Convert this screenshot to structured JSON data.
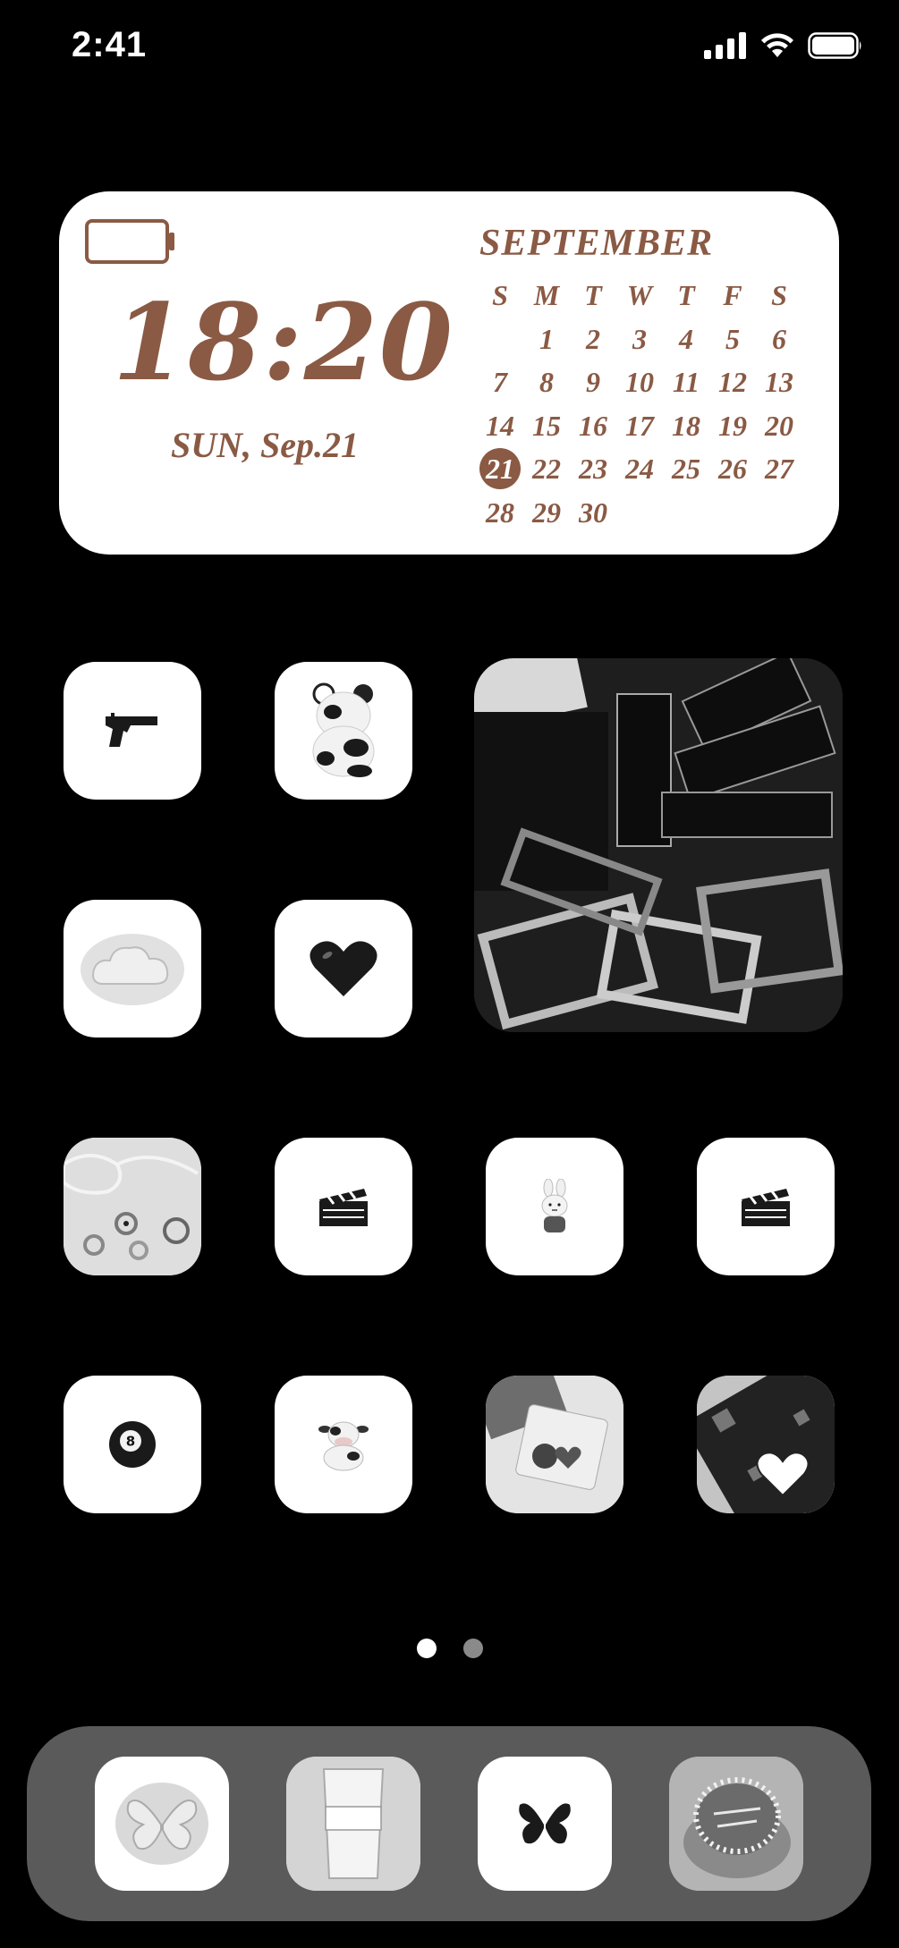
{
  "status_bar": {
    "time": "2:41",
    "signal_icon": "cellular-signal-icon",
    "wifi_icon": "wifi-icon",
    "battery_icon": "battery-icon"
  },
  "widget": {
    "time": "18:20",
    "date": "SUN, Sep.21",
    "month": "SEPTEMBER",
    "weekdays": [
      "S",
      "M",
      "T",
      "W",
      "T",
      "F",
      "S"
    ],
    "weeks": [
      [
        "",
        "1",
        "2",
        "3",
        "4",
        "5",
        "6"
      ],
      [
        "7",
        "8",
        "9",
        "10",
        "11",
        "12",
        "13"
      ],
      [
        "14",
        "15",
        "16",
        "17",
        "18",
        "19",
        "20"
      ],
      [
        "21",
        "22",
        "23",
        "24",
        "25",
        "26",
        "27"
      ],
      [
        "28",
        "29",
        "30",
        "",
        "",
        "",
        ""
      ]
    ],
    "today": "21",
    "accent_color": "#8a5a44",
    "battery_level": 0
  },
  "apps": [
    {
      "icon": "pistol-icon"
    },
    {
      "icon": "cow-bear-figure-icon"
    },
    {
      "icon": "instax-photo-collage-widget"
    },
    {
      "icon": "cloud-icon"
    },
    {
      "icon": "heart-icon"
    },
    {
      "icon": "glasses-rings-photo-icon"
    },
    {
      "icon": "clapperboard-icon"
    },
    {
      "icon": "bunny-figure-icon"
    },
    {
      "icon": "clapperboard-icon"
    },
    {
      "icon": "eight-ball-icon"
    },
    {
      "icon": "cow-figure-icon"
    },
    {
      "icon": "sticker-photo-icon"
    },
    {
      "icon": "composition-notebook-icon"
    }
  ],
  "eight_ball_label": "8",
  "page_indicator": {
    "count": 2,
    "active": 1
  },
  "dock": [
    {
      "icon": "butterfly-glow-icon"
    },
    {
      "icon": "milk-glass-icon"
    },
    {
      "icon": "butterfly-icon"
    },
    {
      "icon": "birthday-cake-icon"
    }
  ]
}
